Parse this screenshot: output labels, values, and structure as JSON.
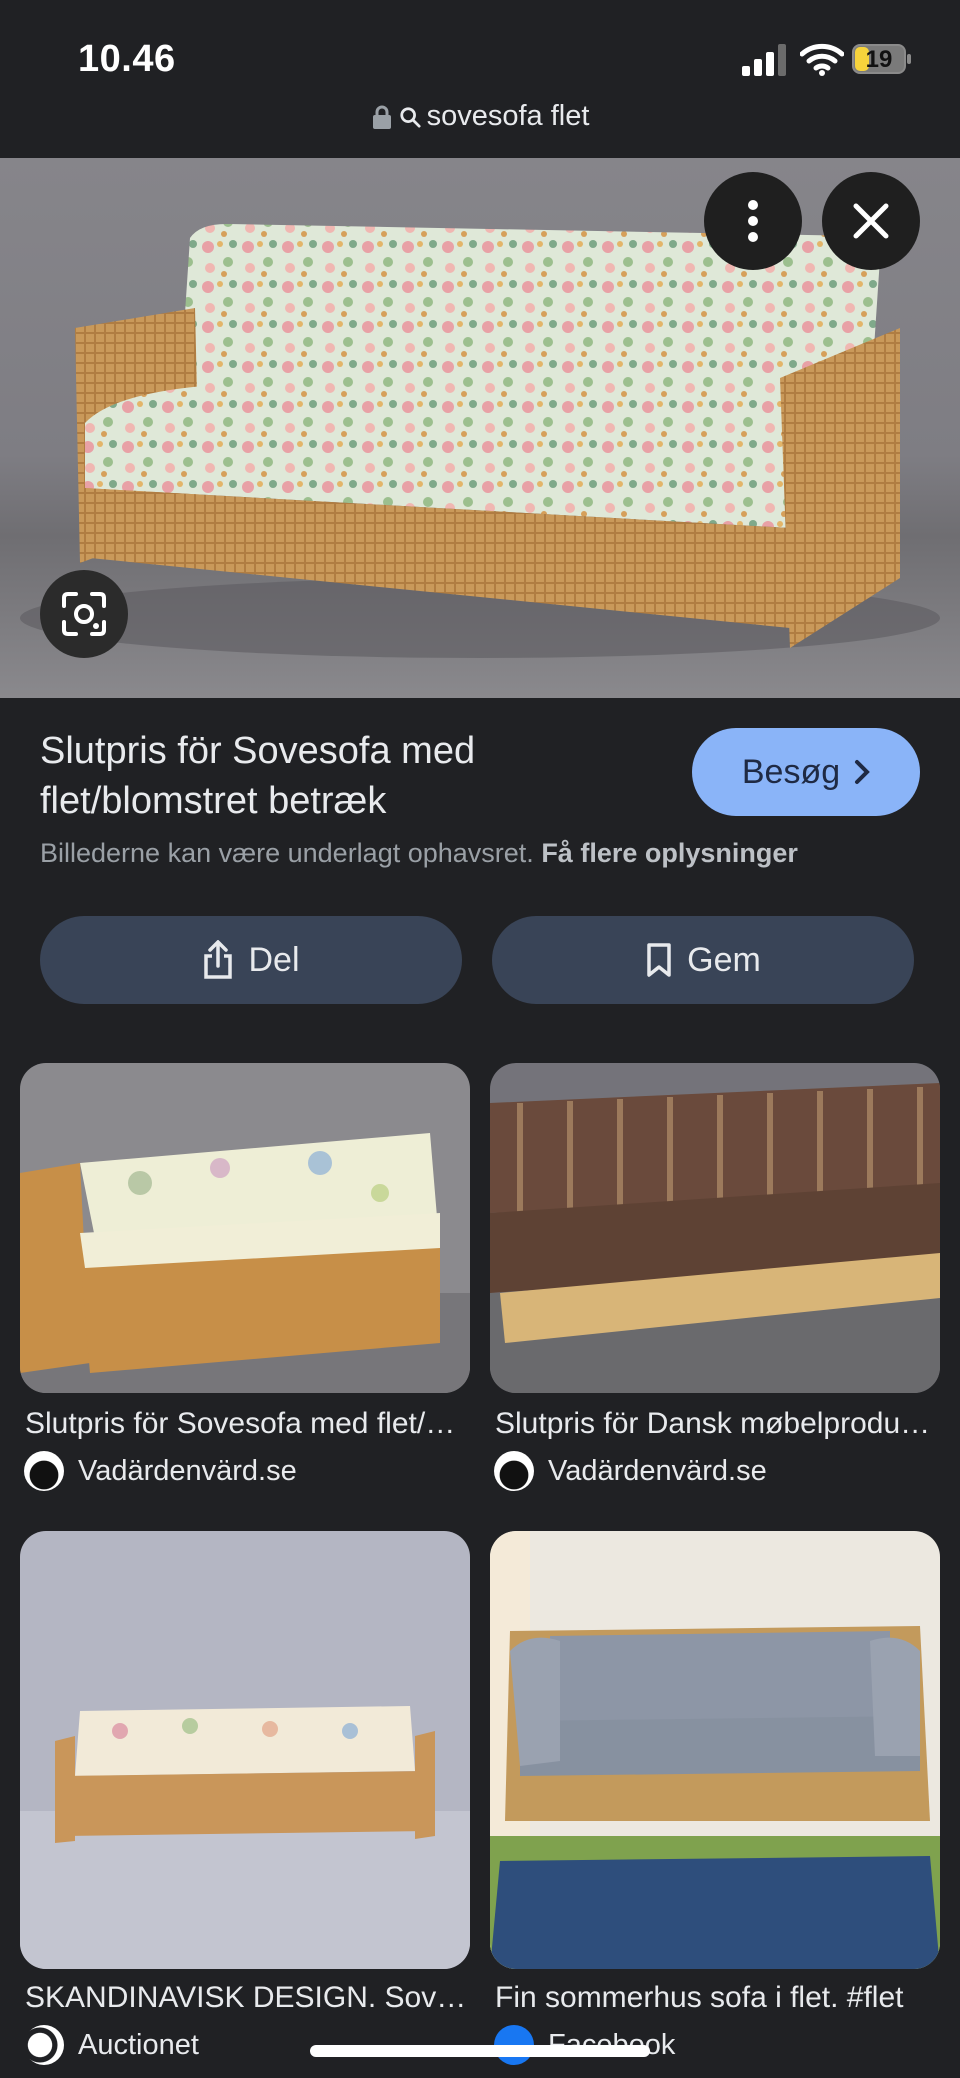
{
  "status": {
    "time": "10.46",
    "battery": "19"
  },
  "browser": {
    "address": "sovesofa flet"
  },
  "viewer": {
    "title": "Slutpris för Sovesofa med flet/blomstret betræk",
    "visit_label": "Besøg",
    "copyright_text": "Billederne kan være underlagt ophavsret.",
    "more_info_link": "Få flere oplysninger",
    "share_label": "Del",
    "save_label": "Gem"
  },
  "results": [
    {
      "title": "Slutpris för Sovesofa med flet/blomstret betræk",
      "source": "Vadärdenvärd.se"
    },
    {
      "title": "Slutpris för Dansk møbelproduktion",
      "source": "Vadärdenvärd.se"
    },
    {
      "title": "SKANDINAVISK DESIGN. Sovesofa",
      "source": "Auctionet"
    },
    {
      "title": "Fin sommerhus sofa i flet. #flet",
      "source": "Facebook"
    }
  ],
  "colors": {
    "background": "#202124",
    "accent_button": "#8ab4f8",
    "action_button": "#394457",
    "battery_fill": "#f6d33c"
  }
}
